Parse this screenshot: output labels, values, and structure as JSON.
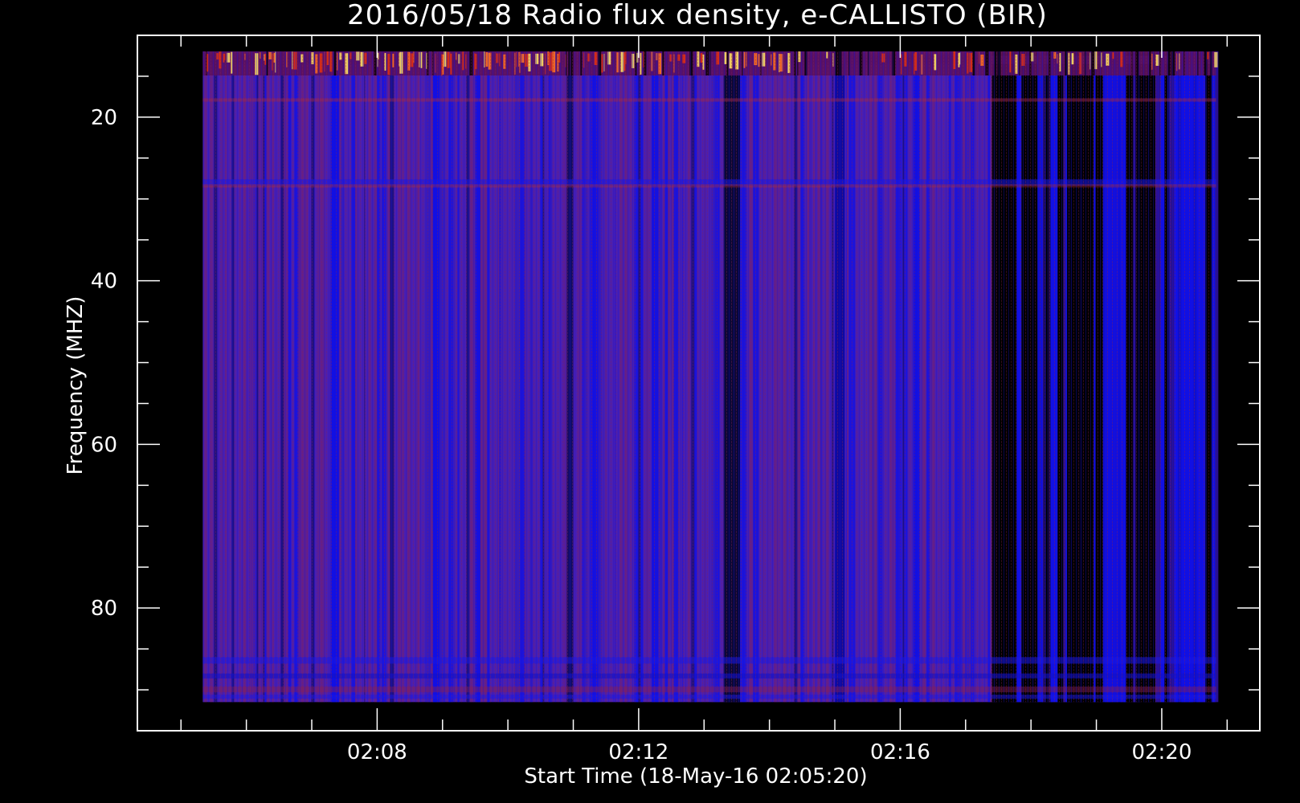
{
  "chart_data": {
    "type": "heatmap",
    "title": "2016/05/18  Radio flux density, e-CALLISTO (BIR)",
    "xlabel": "Start Time (18-May-16 02:05:20)",
    "ylabel": "Frequency (MHZ)",
    "x_range_minutes": [
      "02:05:20",
      "02:20:50"
    ],
    "xlim": [
      "02:04:20",
      "02:21:30"
    ],
    "ylim": [
      10,
      95
    ],
    "y_inverted": true,
    "grid": false,
    "x_ticks": [
      "02:08",
      "02:12",
      "02:16",
      "02:20"
    ],
    "y_ticks": [
      20,
      40,
      60,
      80
    ],
    "colors": {
      "background": "#000000",
      "low": "#000000",
      "mid_low": "#1010e6",
      "mid": "#4a1fb0",
      "mid_high": "#7a1f6a",
      "high": "#e03010",
      "peak": "#ffe060"
    }
  }
}
